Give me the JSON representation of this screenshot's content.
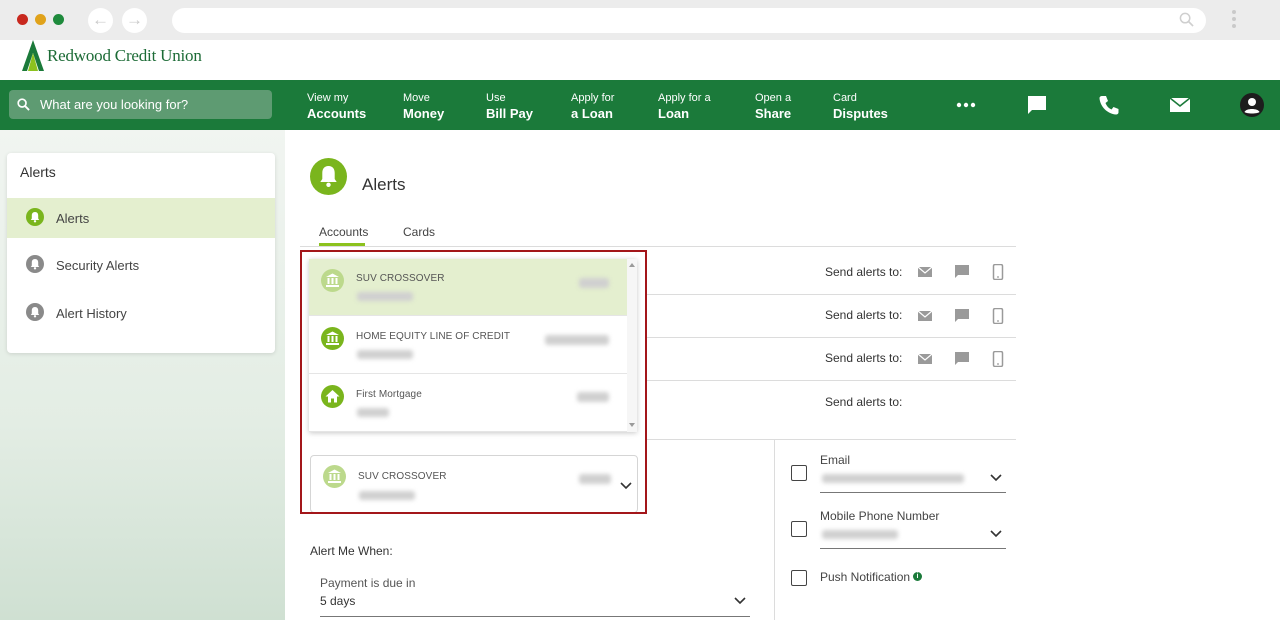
{
  "brand": {
    "name": "Redwood Credit Union",
    "color": "#1b7a3a",
    "accent": "#8cc21e",
    "highlight": "#e4efcf",
    "outline": "#a3161a"
  },
  "search": {
    "placeholder": "What are you looking for?"
  },
  "nav": [
    {
      "l1": "View my",
      "l2": "Accounts"
    },
    {
      "l1": "Move",
      "l2": "Money"
    },
    {
      "l1": "Use",
      "l2": "Bill Pay"
    },
    {
      "l1": "Apply for",
      "l2": "a Loan"
    },
    {
      "l1": "Apply for a",
      "l2": "Loan"
    },
    {
      "l1": "Open a",
      "l2": "Share"
    },
    {
      "l1": "Card",
      "l2": "Disputes"
    }
  ],
  "nav_icons": [
    "more-icon",
    "chat-icon",
    "phone-icon",
    "mail-icon",
    "profile-icon"
  ],
  "sidebar": {
    "title": "Alerts",
    "items": [
      {
        "label": "Alerts",
        "active": true
      },
      {
        "label": "Security Alerts",
        "active": false
      },
      {
        "label": "Alert History",
        "active": false
      }
    ]
  },
  "main": {
    "title": "Alerts",
    "tabs": [
      {
        "label": "Accounts",
        "active": true
      },
      {
        "label": "Cards",
        "active": false
      }
    ],
    "send_rows": [
      {
        "label": "Send alerts to:",
        "icons": true
      },
      {
        "label": "Send alerts to:",
        "icons": true
      },
      {
        "label": "Send alerts to:",
        "icons": true
      },
      {
        "label": "Send alerts to:",
        "icons": false
      }
    ]
  },
  "account_dropdown": {
    "items": [
      {
        "name": "SUV CROSSOVER",
        "icon": "bank-icon",
        "selected": true
      },
      {
        "name": "HOME EQUITY LINE OF CREDIT",
        "icon": "bank-icon",
        "selected": false
      },
      {
        "name": "First Mortgage",
        "icon": "home-icon",
        "selected": false
      }
    ],
    "selected_value": "SUV CROSSOVER"
  },
  "alert_when": {
    "label": "Alert Me When:",
    "field_label": "Payment is due in",
    "field_value": "5 days"
  },
  "delivery": {
    "email_label": "Email",
    "mobile_label": "Mobile Phone Number",
    "push_label": "Push Notification"
  }
}
